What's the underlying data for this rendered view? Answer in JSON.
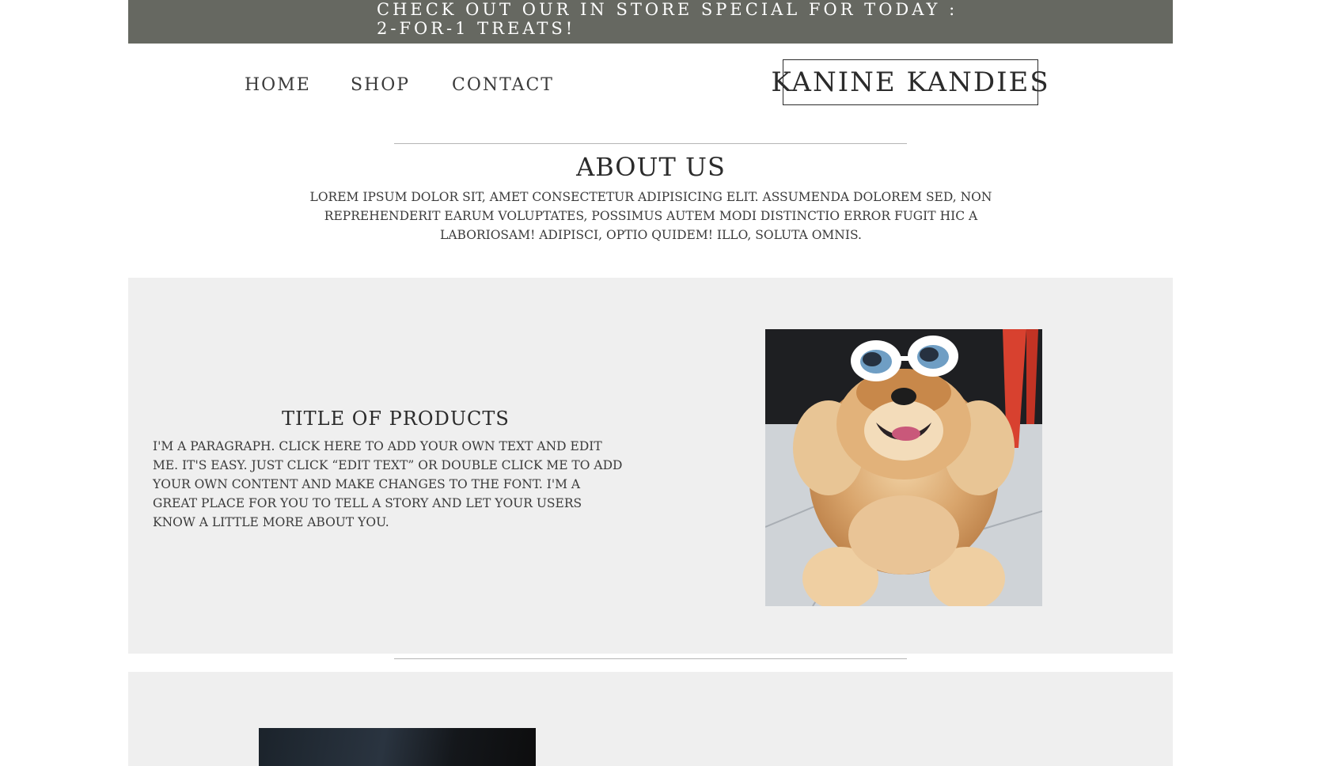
{
  "promo": {
    "text": "Check out our in store special for today : 2-for-1 treats!"
  },
  "nav": {
    "items": [
      "Home",
      "Shop",
      "Contact"
    ]
  },
  "logo": {
    "text": "Kanine Kandies"
  },
  "about": {
    "title": "About Us",
    "body": "Lorem ipsum dolor sit, amet consectetur adipisicing elit. Assumenda dolorem sed, non reprehenderit earum voluptates, possimus autem modi distinctio error fugit hic a laboriosam! Adipisci, optio quidem! Illo, soluta omnis."
  },
  "product": {
    "title": "Title of Products",
    "body": "I'm a paragraph. Click here to add your own text and edit me. It's easy. Just click “Edit Text” or double click me to add your own content and make changes to the font. I'm a great place for you to tell a story and let your users know a little more about you."
  },
  "colors": {
    "promo_bg": "#666861",
    "panel_bg": "#efefef",
    "text": "#2b2b2b"
  },
  "icons": {
    "product_image": "dog-with-sunglasses-photo",
    "second_image": "dark-photo"
  }
}
